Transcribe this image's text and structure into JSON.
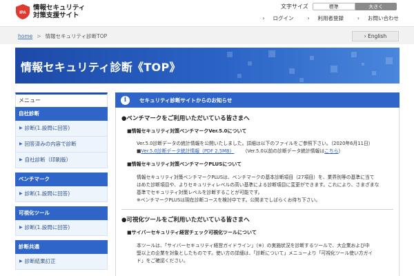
{
  "header": {
    "logo_line1": "情報セキュリティ",
    "logo_line2": "対策支援サイト",
    "logo_mark_text": "IPA",
    "fontsize_label": "文字サイズ",
    "fontsize_standard": "標準",
    "fontsize_large": "大きく",
    "links": [
      "ログイン",
      "利用者登録",
      "お問い合わせ"
    ],
    "accent_color": "#e03a2f"
  },
  "breadcrumb": {
    "home": "home",
    "separator": ">",
    "current": "情報セキュリティ診断TOP"
  },
  "english_button": "English",
  "banner": {
    "title": "情報セキュリティ診断《TOP》",
    "color": "#2b64c6"
  },
  "sidebar": {
    "heading": "メニュー",
    "groups": [
      {
        "title": "自社診断",
        "items": [
          "診断(1.設問に回答)",
          "回答済みの内容で診断",
          "自社診断（印刷版）"
        ]
      },
      {
        "title": "ベンチマーク",
        "items": [
          "診断(1.設問に回答)"
        ]
      },
      {
        "title": "可視化ツール",
        "items": [
          "診断(1.設問に回答)"
        ]
      },
      {
        "title": "診断共通",
        "items": [
          "診断結果訂正"
        ]
      }
    ]
  },
  "main": {
    "notice_title": "セキュリティ診断サイトからのお知らせ",
    "section1_title": "●ベンチマークをご利用いただいている皆さまへ",
    "s1_sub1": "■情報セキュリティ対策ベンチマークVer.5.0について",
    "s1_p1": "Ver.5.0診断データの統計情報を公開いたしました。詳細は以下のファイルをご参照下さい。（2020年6月11日）",
    "s1_link1": "Ver.5.0診断データ統計情報（PDF 2.5MB）",
    "s1_p1b_pre": "（Ver.5.0以前の診断データ統計情報は",
    "s1_p1b_link": "こちら",
    "s1_p1b_post": "）",
    "s1_sub2": "■情報セキュリティ対策ベンチマークPLUSについて",
    "s1_p2_l1": "情報セキュリティ対策ベンチマークPLUSは、ベンチマークの基本診断項目（27項目）を、業界別等の基準に当て",
    "s1_p2_l2": "はめた診断項目や、よりセキュリティレベルの高い基準による診断項目に変更ができます。これにより、さまざまな",
    "s1_p2_l3": "基準でセキュリティ対策レベルを診断することが可能です。",
    "s1_p2_l4": "※ベンチマークPLUSは現在診断コースを検討中です。公開までしばらくお待ち下さい。",
    "section2_title": "●可視化ツールをご利用いただいている皆さまへ",
    "s2_sub1": "■サイバーセキュリティ経営チェック可視化ツールについて",
    "s2_p1_l1": "本ツールは、「サイバーセキュリティ経営ガイドライン」（※）の実施状況を診断するツールで、大企業および中",
    "s2_p1_l2": "堅以上の企業を対象としたものです。使い方の詳細は、「診断について」メニューより「可視化ツール使い方ガイ",
    "s2_p1_l3": "ド」をご確認ください。"
  }
}
